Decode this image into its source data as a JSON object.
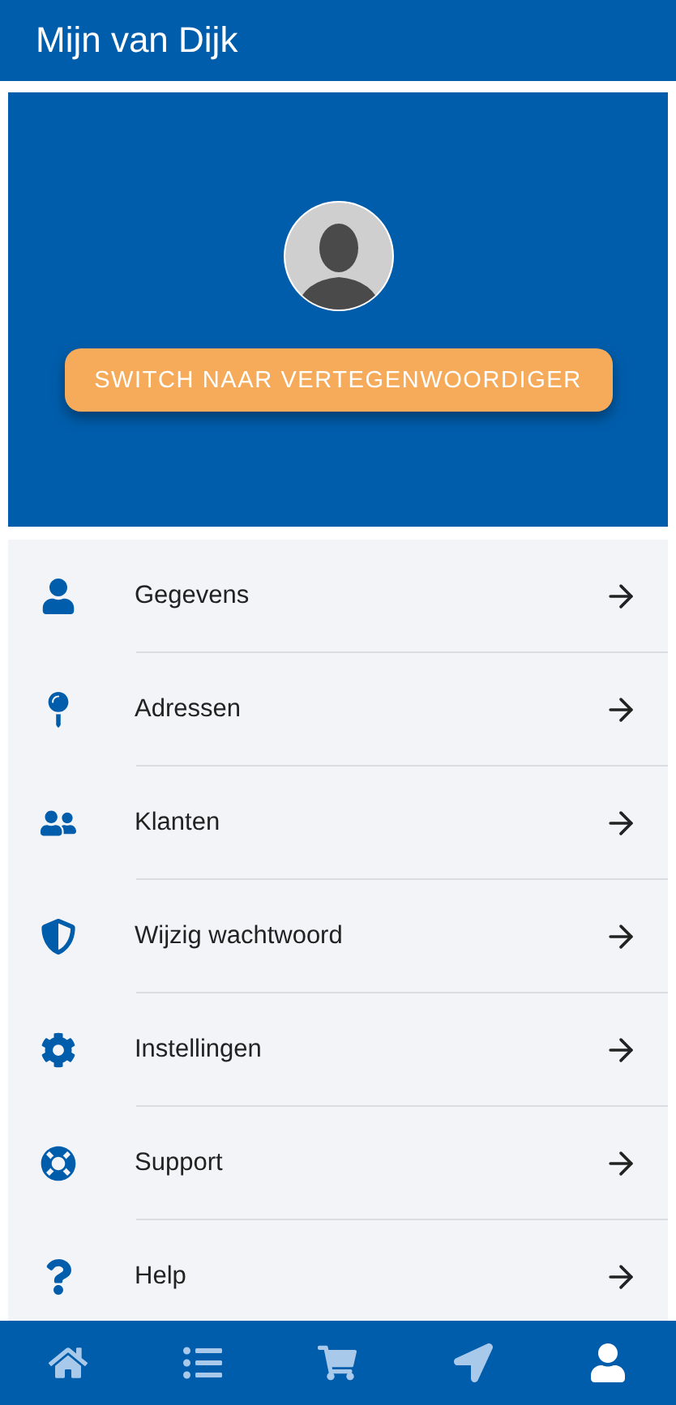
{
  "header": {
    "title": "Mijn van Dijk"
  },
  "profile": {
    "switch_button": "SWITCH NAAR VERTEGENWOORDIGER"
  },
  "menu": [
    {
      "kind": "user",
      "label": "Gegevens"
    },
    {
      "kind": "pin",
      "label": "Adressen"
    },
    {
      "kind": "users",
      "label": "Klanten"
    },
    {
      "kind": "shield",
      "label": "Wijzig wachtwoord"
    },
    {
      "kind": "gear",
      "label": "Instellingen"
    },
    {
      "kind": "lifering",
      "label": "Support"
    },
    {
      "kind": "question",
      "label": "Help"
    }
  ],
  "bottom_nav": [
    {
      "kind": "home",
      "selected": false
    },
    {
      "kind": "list",
      "selected": false
    },
    {
      "kind": "cart",
      "selected": false
    },
    {
      "kind": "navigate",
      "selected": false
    },
    {
      "kind": "user",
      "selected": true
    }
  ]
}
